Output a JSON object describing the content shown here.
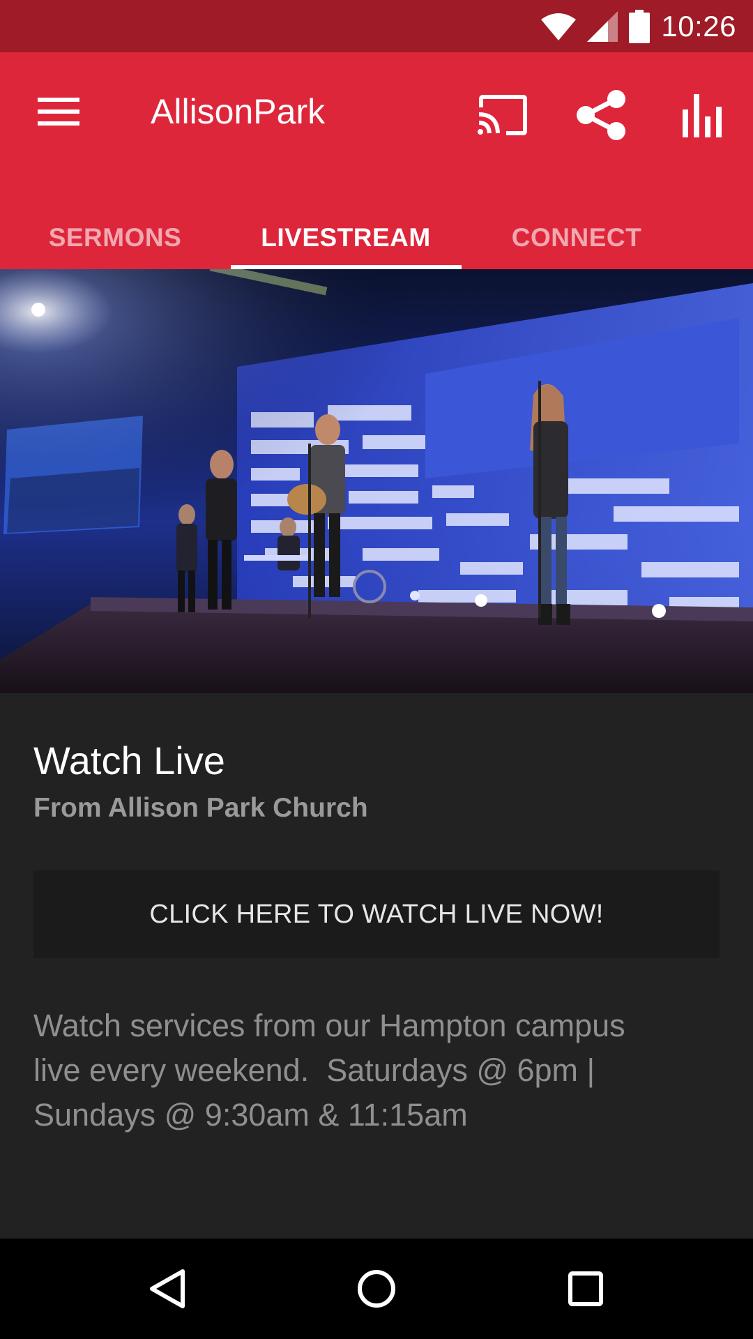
{
  "status_bar": {
    "time": "10:26",
    "icons": [
      "wifi-icon",
      "signal-icon",
      "battery-icon"
    ]
  },
  "app_bar": {
    "title": "AllisonPark",
    "icons": [
      "menu-icon",
      "cast-icon",
      "share-icon",
      "bar-chart-icon"
    ],
    "color": "#de263b",
    "status_color": "#9e1b27"
  },
  "tabs": [
    {
      "label": "SERMONS",
      "active": false
    },
    {
      "label": "LIVESTREAM",
      "active": true
    },
    {
      "label": "CONNECT",
      "active": false
    }
  ],
  "livestream": {
    "title": "Watch Live",
    "subtitle": "From Allison Park Church",
    "button_label": "CLICK HERE TO WATCH LIVE NOW!",
    "description": "Watch services from our Hampton campus\nlive every weekend.  Saturdays @ 6pm |\nSundays @ 9:30am & 11:15am"
  },
  "nav_bar": {
    "icons": [
      "back-icon",
      "home-icon",
      "recents-icon"
    ]
  }
}
